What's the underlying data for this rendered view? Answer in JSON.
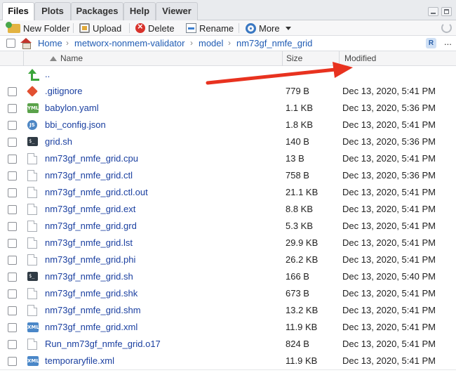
{
  "tabs": [
    {
      "label": "Files",
      "active": true
    },
    {
      "label": "Plots",
      "active": false
    },
    {
      "label": "Packages",
      "active": false
    },
    {
      "label": "Help",
      "active": false
    },
    {
      "label": "Viewer",
      "active": false
    }
  ],
  "toolbar": {
    "new_folder": "New Folder",
    "upload": "Upload",
    "delete": "Delete",
    "rename": "Rename",
    "more": "More"
  },
  "breadcrumb": {
    "home": "Home",
    "items": [
      "metworx-nonmem-validator",
      "model",
      "nm73gf_nmfe_grid"
    ],
    "more": "..."
  },
  "header": {
    "name": "Name",
    "size": "Size",
    "modified": "Modified"
  },
  "files": [
    {
      "name": "..",
      "icon": "parent-dir-icon",
      "size": "",
      "modified": ""
    },
    {
      "name": ".gitignore",
      "icon": "git-icon",
      "size": "779 B",
      "modified": "Dec 13, 2020, 5:41 PM"
    },
    {
      "name": "babylon.yaml",
      "icon": "yaml-icon",
      "size": "1.1 KB",
      "modified": "Dec 13, 2020, 5:36 PM"
    },
    {
      "name": "bbi_config.json",
      "icon": "json-icon",
      "size": "1.8 KB",
      "modified": "Dec 13, 2020, 5:41 PM"
    },
    {
      "name": "grid.sh",
      "icon": "shell-icon",
      "size": "140 B",
      "modified": "Dec 13, 2020, 5:36 PM"
    },
    {
      "name": "nm73gf_nmfe_grid.cpu",
      "icon": "document-icon",
      "size": "13 B",
      "modified": "Dec 13, 2020, 5:41 PM"
    },
    {
      "name": "nm73gf_nmfe_grid.ctl",
      "icon": "document-icon",
      "size": "758 B",
      "modified": "Dec 13, 2020, 5:36 PM"
    },
    {
      "name": "nm73gf_nmfe_grid.ctl.out",
      "icon": "document-icon",
      "size": "21.1 KB",
      "modified": "Dec 13, 2020, 5:41 PM"
    },
    {
      "name": "nm73gf_nmfe_grid.ext",
      "icon": "document-icon",
      "size": "8.8 KB",
      "modified": "Dec 13, 2020, 5:41 PM"
    },
    {
      "name": "nm73gf_nmfe_grid.grd",
      "icon": "document-icon",
      "size": "5.3 KB",
      "modified": "Dec 13, 2020, 5:41 PM"
    },
    {
      "name": "nm73gf_nmfe_grid.lst",
      "icon": "document-icon",
      "size": "29.9 KB",
      "modified": "Dec 13, 2020, 5:41 PM"
    },
    {
      "name": "nm73gf_nmfe_grid.phi",
      "icon": "document-icon",
      "size": "26.2 KB",
      "modified": "Dec 13, 2020, 5:41 PM"
    },
    {
      "name": "nm73gf_nmfe_grid.sh",
      "icon": "shell-icon",
      "size": "166 B",
      "modified": "Dec 13, 2020, 5:40 PM"
    },
    {
      "name": "nm73gf_nmfe_grid.shk",
      "icon": "document-icon",
      "size": "673 B",
      "modified": "Dec 13, 2020, 5:41 PM"
    },
    {
      "name": "nm73gf_nmfe_grid.shm",
      "icon": "document-icon",
      "size": "13.2 KB",
      "modified": "Dec 13, 2020, 5:41 PM"
    },
    {
      "name": "nm73gf_nmfe_grid.xml",
      "icon": "xml-icon",
      "size": "11.9 KB",
      "modified": "Dec 13, 2020, 5:41 PM"
    },
    {
      "name": "Run_nm73gf_nmfe_grid.o17",
      "icon": "document-icon",
      "size": "824 B",
      "modified": "Dec 13, 2020, 5:41 PM"
    },
    {
      "name": "temporaryfile.xml",
      "icon": "xml-icon",
      "size": "11.9 KB",
      "modified": "Dec 13, 2020, 5:41 PM"
    }
  ],
  "icon_labels": {
    "yaml": "YML",
    "json": "JS",
    "xml": "XML",
    "shell": "$_",
    "project": "R"
  },
  "colors": {
    "link": "#1a3fa0",
    "arrow": "#e8321f"
  }
}
